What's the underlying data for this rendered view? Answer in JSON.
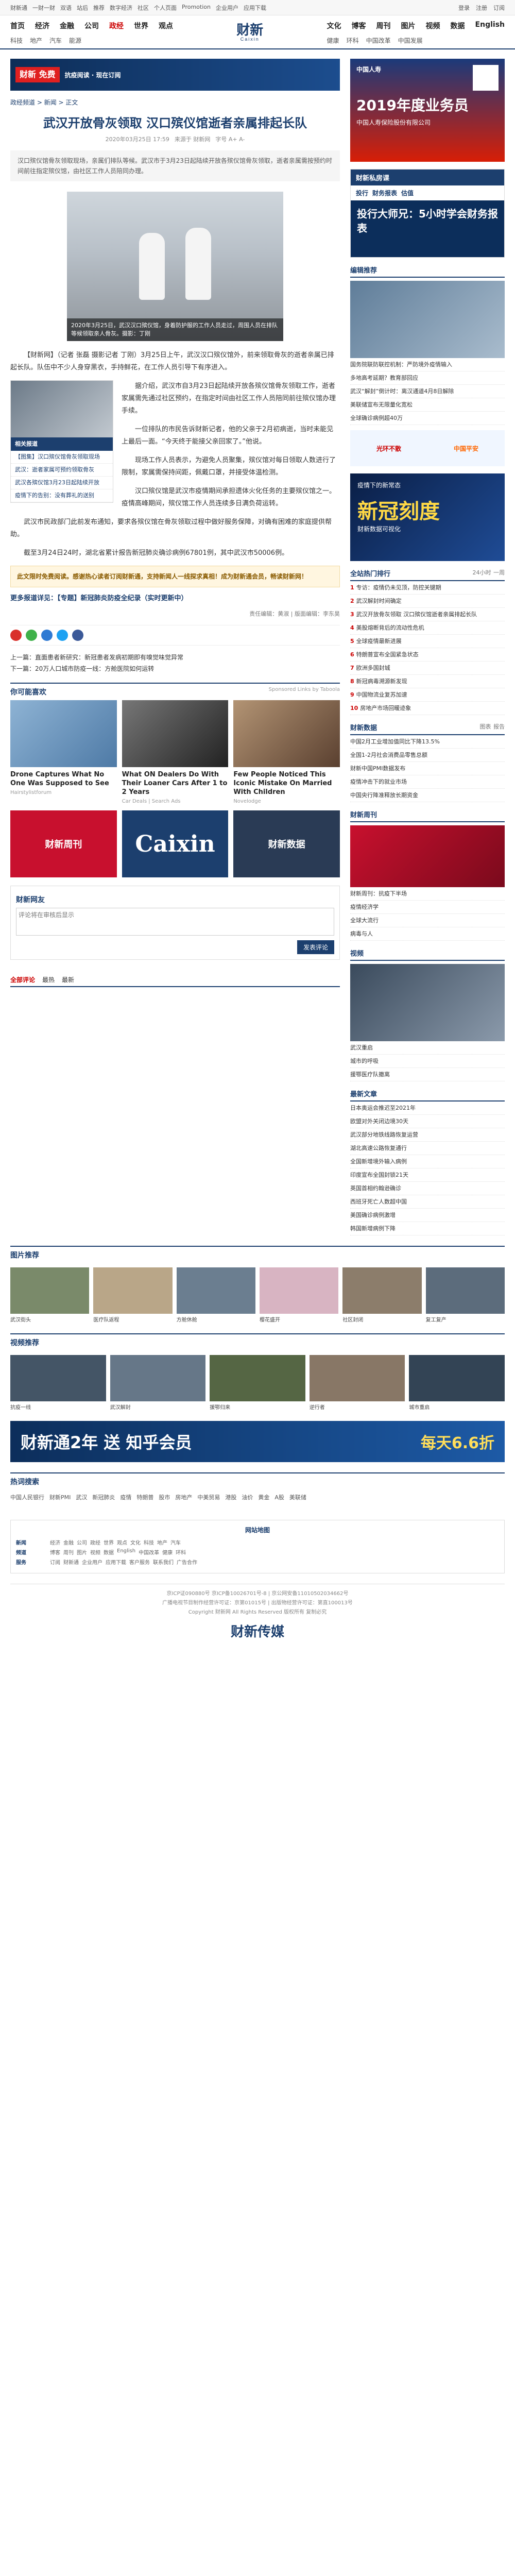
{
  "topbar": {
    "links": [
      "财新通",
      "一财一财",
      "双语",
      "站后",
      "推荐",
      "数字经济",
      "社区",
      "个人页面",
      "Promotion",
      "企业用户",
      "应用下载"
    ],
    "logo": "财新",
    "logo_en": "Caixin",
    "login": "登录",
    "register": "注册",
    "subscribe": "订阅"
  },
  "nav": {
    "main": [
      "首页",
      "经济",
      "金融",
      "公司",
      "政经",
      "世界",
      "观点",
      "文化",
      "博客",
      "周刊",
      "图片",
      "视频",
      "数据",
      "English"
    ],
    "sub": [
      "科技",
      "地产",
      "汽车",
      "能源",
      "健康",
      "环科",
      "中国改革",
      "中国发展"
    ],
    "active": "政经"
  },
  "ad_strip": {
    "badge": "财新 免费",
    "text": "抗疫阅读 · 现在订阅"
  },
  "crumb": "政经频道 > 新闻 > 正文",
  "article": {
    "title": "武汉开放骨灰领取 汉口殡仪馆逝者亲属排起长队",
    "meta_time": "2020年03月25日 17:59",
    "meta_source": "来源于 财新网",
    "meta_extra": "字号 A+ A-",
    "summary": "汉口殡仪馆骨灰领取现场，亲属们排队等候。武汉市于3月23日起陆续开放各殡仪馆骨灰领取，逝者亲属需按预约时间前往指定殡仪馆，由社区工作人员陪同办理。",
    "photo_caption": "2020年3月25日，武汉汉口殡仪馆，身着防护服的工作人员走过，周围人员在排队等候领取亲人骨灰。摄影：丁刚",
    "related_head": "相关报道",
    "related": [
      "【图集】汉口殡仪馆骨灰领取现场",
      "武汉：逝者家属可预约领取骨灰",
      "武汉各殡仪馆3月23日起陆续开放",
      "疫情下的告别：没有葬礼的送别"
    ],
    "paragraphs": [
      "【财新网】（记者 张磊 摄影记者 丁刚）3月25日上午，武汉汉口殡仪馆外，前来领取骨灰的逝者亲属已排起长队。队伍中不少人身穿黑衣，手持鲜花，在工作人员引导下有序进入。",
      "据介绍，武汉市自3月23日起陆续开放各殡仪馆骨灰领取工作，逝者家属需先通过社区预约，在指定时间由社区工作人员陪同前往殡仪馆办理手续。",
      "一位排队的市民告诉财新记者，他的父亲于2月初病逝，当时未能见上最后一面。“今天终于能接父亲回家了。”他说。",
      "现场工作人员表示，为避免人员聚集，殡仪馆对每日领取人数进行了限制，家属需保持间距，佩戴口罩，并接受体温检测。",
      "汉口殡仪馆是武汉市疫情期间承担遗体火化任务的主要殡仪馆之一。疫情高峰期间，殡仪馆工作人员连续多日满负荷运转。",
      "武汉市民政部门此前发布通知，要求各殡仪馆在骨灰领取过程中做好服务保障，对确有困难的家庭提供帮助。",
      "截至3月24日24时，湖北省累计报告新冠肺炎确诊病例67801例，其中武汉市50006例。"
    ],
    "note": "此文限时免费阅读。感谢热心读者订阅财新通，支持新闻人一线探求真相！成为财新通会员，畅读财新网！",
    "special": "更多报道详见：【专题】新冠肺炎防疫全纪录（实时更新中）",
    "editor": "责任编辑：黄淑 | 版面编辑：李东昊",
    "prev": "上一篇：直面患者新研究：新冠患者发病初期即有嗅觉味觉异常",
    "next": "下一篇：20万人口城市防疫一线：方舱医院如何运转"
  },
  "recommend": {
    "title": "你可能喜欢",
    "sponsor": "Sponsored Links by Taboola",
    "cards": [
      {
        "title": "Drone Captures What No One Was Supposed to See",
        "source": "Hairstylistforum"
      },
      {
        "title": "What ON Dealers Do With Their Loaner Cars After 1 to 2 Years",
        "source": "Car Deals | Search Ads"
      },
      {
        "title": "Few People Noticed This Iconic Mistake On Married With Children",
        "source": "Novelodge"
      }
    ],
    "row2": [
      "财新周刊",
      "Caixin",
      "财新数据"
    ]
  },
  "comment": {
    "title": "财新网友",
    "placeholder": "评论将在审核后显示",
    "button": "发表评论"
  },
  "sub_tabs": [
    "全部评论",
    "最热",
    "最新"
  ],
  "pic_section": {
    "title": "图片推荐",
    "items": [
      "武汉街头",
      "医疗队返程",
      "方舱休舱",
      "樱花盛开",
      "社区封闭",
      "复工复产"
    ]
  },
  "video_section": {
    "title": "视频推荐",
    "items": [
      "抗疫一线",
      "武汉解封",
      "援鄂归来",
      "逆行者",
      "城市重启"
    ]
  },
  "banner": {
    "left": "财新通2年 送 知乎会员",
    "right": "每天6.6折"
  },
  "hot_tags": {
    "title": "热词搜索",
    "items": [
      "中国人民银行",
      "财新PMI",
      "武汉",
      "新冠肺炎",
      "疫情",
      "特朗普",
      "股市",
      "房地产",
      "中美贸易",
      "港股",
      "油价",
      "黄金",
      "A股",
      "美联储"
    ]
  },
  "sitemap": {
    "title": "网站地图",
    "rows": [
      {
        "head": "新闻",
        "items": [
          "经济",
          "金融",
          "公司",
          "政经",
          "世界",
          "观点",
          "文化",
          "科技",
          "地产",
          "汽车"
        ]
      },
      {
        "head": "频道",
        "items": [
          "博客",
          "周刊",
          "图片",
          "视频",
          "数据",
          "English",
          "中国改革",
          "健康",
          "环科"
        ]
      },
      {
        "head": "服务",
        "items": [
          "订阅",
          "财新通",
          "企业用户",
          "应用下载",
          "客户服务",
          "联系我们",
          "广告合作"
        ]
      }
    ]
  },
  "footer": {
    "lines": [
      "京ICP证090880号 京ICP备10026701号-8 | 京公网安备11010502034662号",
      "广播电视节目制作经营许可证：京第01015号 | 出版物经营许可证：第直100013号",
      "Copyright 财新网 All Rights Reserved 版权所有 复制必究"
    ],
    "logo": "财新传媒"
  },
  "side": {
    "ad": {
      "brand": "中国人寿",
      "big": "2019年度业务员",
      "sub": "中国人寿保险股份有限公司"
    },
    "private": {
      "title": "财新私房课",
      "tabs": [
        "投行",
        "财务报表",
        "估值"
      ],
      "promo": "投行大师兄：5小时学会财务报表"
    },
    "editor_picks": {
      "title": "编辑推荐",
      "items": [
        "国务院联防联控机制：严防境外疫情输入",
        "多地高考延期？教育部回应",
        "武汉“解封”倒计时：离汉通道4月8日解除",
        "美联储宣布无限量化宽松",
        "全球确诊病例超40万"
      ]
    },
    "mini_ad": [
      "光环不散",
      "中国平安"
    ],
    "xg": {
      "label": "疫情下的新常态",
      "big": "新冠刻度",
      "sub": "财新数据可视化"
    },
    "rank": {
      "title": "全站热门排行",
      "tabs": [
        "24小时",
        "一周"
      ],
      "items": [
        "专访：疫情仍未见顶，防控关键期",
        "武汉解封时间确定",
        "武汉开放骨灰领取 汉口殡仪馆逝者亲属排起长队",
        "美股熔断背后的流动性危机",
        "全球疫情最新进展",
        "特朗普宣布全国紧急状态",
        "欧洲多国封城",
        "新冠病毒溯源新发现",
        "中国物流业复苏加速",
        "房地产市场回暖迹象"
      ]
    },
    "reports": {
      "title": "财新数据",
      "tabs": [
        "图表",
        "报告"
      ],
      "items": [
        "中国2月工业增加值同比下降13.5%",
        "全国1-2月社会消费品零售总额",
        "财新中国PMI数据发布",
        "疫情冲击下的就业市场",
        "中国央行降准释放长期资金"
      ]
    },
    "weekly": {
      "title": "财新周刊",
      "items": [
        "财新周刊：抗疫下半场",
        "疫情经济学",
        "全球大流行",
        "病毒与人"
      ]
    },
    "videos": {
      "title": "视频",
      "items": [
        "武汉重启",
        "城市的呼吸",
        "援鄂医疗队撤离"
      ]
    },
    "latest": {
      "title": "最新文章",
      "items": [
        "日本奥运会推迟至2021年",
        "欧盟对外关闭边境30天",
        "武汉部分地铁线路恢复运营",
        "湖北高速公路恢复通行",
        "全国新增境外输入病例",
        "印度宣布全国封锁21天",
        "英国首相约翰逊确诊",
        "西班牙死亡人数超中国",
        "美国确诊病例激增",
        "韩国新增病例下降"
      ]
    }
  }
}
